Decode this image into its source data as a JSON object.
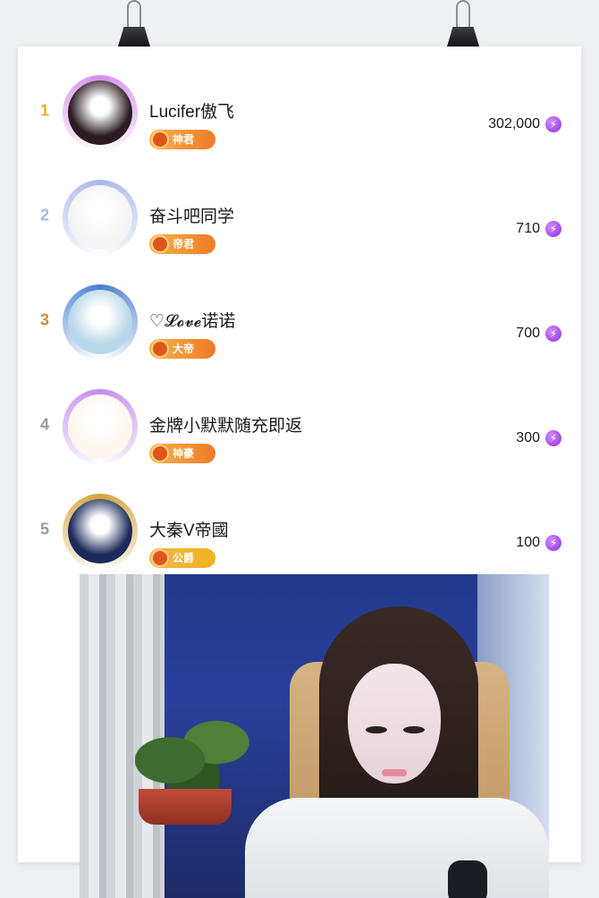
{
  "ranking": [
    {
      "rank": "1",
      "rank_color": "#e8b020",
      "name": "Lucifer傲飞",
      "badge": "神君",
      "badge_color": "#f07a26",
      "score": "302,000",
      "frame_color": "#d98cf0",
      "avatar_color": "#2a1c22",
      "avatar_icon": "portrait-woman-icon"
    },
    {
      "rank": "2",
      "rank_color": "#a9b7e8",
      "name": "奋斗吧同学",
      "badge": "帝君",
      "badge_color": "#f07a26",
      "score": "710",
      "frame_color": "#a9b7e8",
      "avatar_color": "#f4f4f4",
      "avatar_icon": "meme-face-icon"
    },
    {
      "rank": "3",
      "rank_color": "#d08a3a",
      "name": "♡𝓛𝓸𝓿𝓮诺诺",
      "badge": "大帝",
      "badge_color": "#f07a26",
      "score": "700",
      "frame_color": "#4a7fd0",
      "avatar_color": "#b8d7e8",
      "avatar_icon": "lotus-icon"
    },
    {
      "rank": "4",
      "rank_color": "#9a9a9a",
      "name": "金牌小默默随充即返",
      "badge": "神豪",
      "badge_color": "#f07a26",
      "score": "300",
      "frame_color": "#c68bef",
      "avatar_color": "#fff7ee",
      "avatar_icon": "rabbit-icon"
    },
    {
      "rank": "5",
      "rank_color": "#9a9a9a",
      "name": "大秦V帝國",
      "badge": "公爵",
      "badge_color": "#f0b21e",
      "score": "100",
      "frame_color": "#d4a33a",
      "avatar_color": "#1b2a5a",
      "avatar_icon": "empire-logo-icon"
    }
  ],
  "coin_icon": "lightning-coin-icon",
  "coin_glyph": "⚡",
  "colors": {
    "page_background": "#eef0f3",
    "paper": "#ffffff",
    "coin": "#8a2be2"
  }
}
